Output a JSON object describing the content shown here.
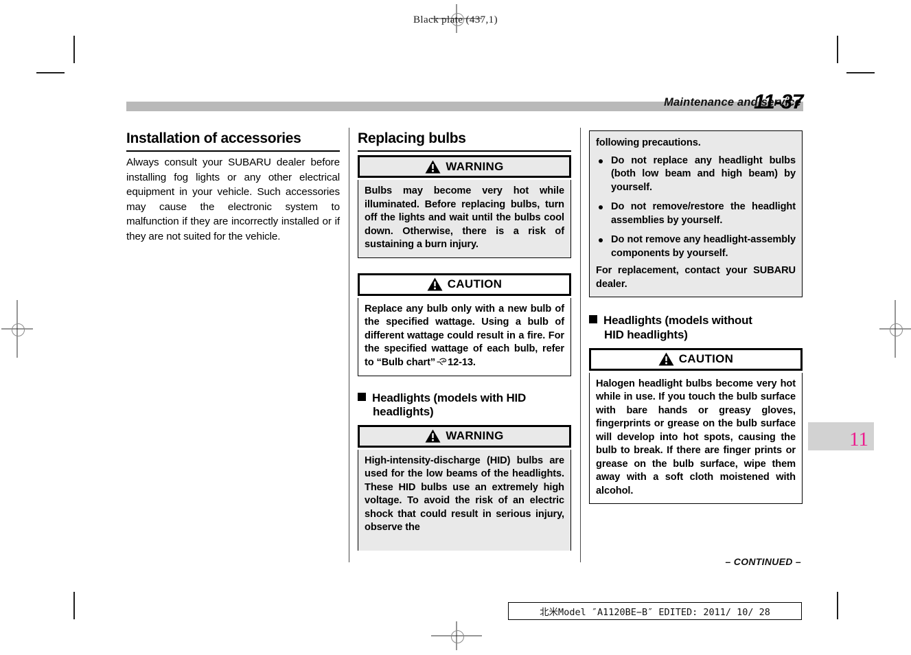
{
  "print_marks": {
    "plate_label": "Black plate (437,1)"
  },
  "running_head": {
    "section": "Maintenance and service",
    "page_number": "11-37"
  },
  "thumb_tab": {
    "chapter": "11",
    "color": "#ec1c8d",
    "background": "#d2d2d2"
  },
  "columns": {
    "column1": {
      "heading": "Installation of accessories",
      "paragraph": "Always consult your SUBARU dealer before installing fog lights or any other electrical equipment in your vehicle. Such accessories may cause the electronic system to malfunction if they are incorrectly installed or if they are not suited for the vehicle."
    },
    "column2": {
      "heading": "Replacing bulbs",
      "warning_bulbs": {
        "type": "WARNING",
        "icon": "warning-triangle-icon",
        "body": "Bulbs may become very hot while illuminated. Before replacing bulbs, turn off the lights and wait until the bulbs cool down. Otherwise, there is a risk of sustaining a burn injury."
      },
      "caution_wattage": {
        "type": "CAUTION",
        "icon": "warning-triangle-icon",
        "body_part1": "Replace any bulb only with a new bulb of the specified wattage. Using a bulb of different wattage could result in a fire. For the specified wattage of each bulb, refer to “Bulb chart”",
        "reference_icon": "pointing-hand-icon",
        "reference": "12-13."
      },
      "subheading": {
        "line1": "Headlights (models with HID",
        "line2": "headlights)"
      },
      "warning_hid": {
        "type": "WARNING",
        "icon": "warning-triangle-icon",
        "body": "High-intensity-discharge (HID) bulbs are used for the low beams of the headlights. These HID bulbs use an extremely high voltage. To avoid the risk of an electric shock that could result in serious injury, observe the"
      }
    },
    "column3": {
      "warning_hid_continued": {
        "intro": "following precautions.",
        "bullets": [
          "Do not replace any headlight bulbs (both low beam and high beam) by yourself.",
          "Do not remove/restore the headlight assemblies by yourself.",
          "Do not remove any headlight-assembly components by yourself."
        ],
        "closing": "For replacement, contact your SUBARU dealer."
      },
      "subheading": {
        "line1": "Headlights (models without",
        "line2": "HID headlights)"
      },
      "caution_halogen": {
        "type": "CAUTION",
        "icon": "warning-triangle-icon",
        "body": "Halogen headlight bulbs become very hot while in use. If you touch the bulb surface with bare hands or greasy gloves, fingerprints or grease on the bulb surface will develop into hot spots, causing the bulb to break. If there are finger prints or grease on the bulb surface, wipe them away with a soft cloth moistened with alcohol."
      }
    }
  },
  "footer": {
    "continued": "– CONTINUED –",
    "stamp": "北米Model ″A1120BE−B″ EDITED: 2011/ 10/ 28"
  }
}
